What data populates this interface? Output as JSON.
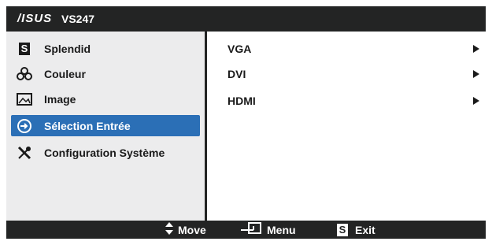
{
  "title": {
    "brand": "/ISUS",
    "model": "VS247"
  },
  "menu": {
    "items": [
      {
        "label": "Splendid",
        "icon": "splendid-s-icon"
      },
      {
        "label": "Couleur",
        "icon": "color-dots-icon"
      },
      {
        "label": "Image",
        "icon": "image-icon"
      },
      {
        "label": "Sélection Entrée",
        "icon": "input-select-icon",
        "selected": true
      },
      {
        "label": "Configuration Système",
        "icon": "wrench-screwdriver-icon"
      }
    ]
  },
  "submenu": {
    "items": [
      {
        "label": "VGA"
      },
      {
        "label": "DVI"
      },
      {
        "label": "HDMI"
      }
    ]
  },
  "footer": {
    "move_label": "Move",
    "menu_label": "Menu",
    "exit_label": "Exit",
    "exit_key": "S",
    "splendid_key": "S"
  },
  "colors": {
    "selected": "#2b6fb6",
    "bar": "#232424",
    "panel": "#ececed"
  }
}
